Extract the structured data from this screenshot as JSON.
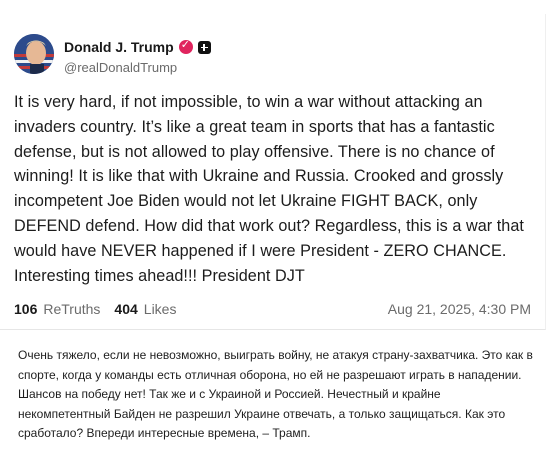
{
  "post": {
    "display_name": "Donald J. Trump",
    "handle": "@realDonaldTrump",
    "text": "It is very hard, if not impossible, to win a war without attacking an invaders country. It’s like a great team in sports that has a fantastic defense, but is not allowed to play offensive. There is no chance of winning! It is like that with Ukraine and Russia. Crooked and grossly incompetent Joe Biden would not let Ukraine FIGHT BACK, only DEFEND defend. How did that work out? Regardless, this is a war that would have NEVER happened if I were President - ZERO CHANCE. Interesting times ahead!!! President DJT",
    "retruths_count": "106",
    "retruths_label": "ReTruths",
    "likes_count": "404",
    "likes_label": "Likes",
    "date": "Aug 21, 2025, 4:30 PM"
  },
  "translation": {
    "text": "Очень тяжело, если не невозможно, выиграть войну, не атакуя страну-захватчика. Это как в спорте, когда у команды есть отличная оборона, но ей не разрешают играть в нападении. Шансов на победу нет! Так же и с Украиной и Россией. Нечестный и крайне некомпетентный Байден не разрешил Украине отвечать, а только защищаться. Как это сработало? Впереди интересные времена, – Трамп."
  },
  "icons": {
    "verified": "verified-badge-icon",
    "plus": "plus-icon",
    "avatar": "avatar"
  },
  "colors": {
    "badge": "#e0245e",
    "muted_text": "#6b6b6b"
  }
}
